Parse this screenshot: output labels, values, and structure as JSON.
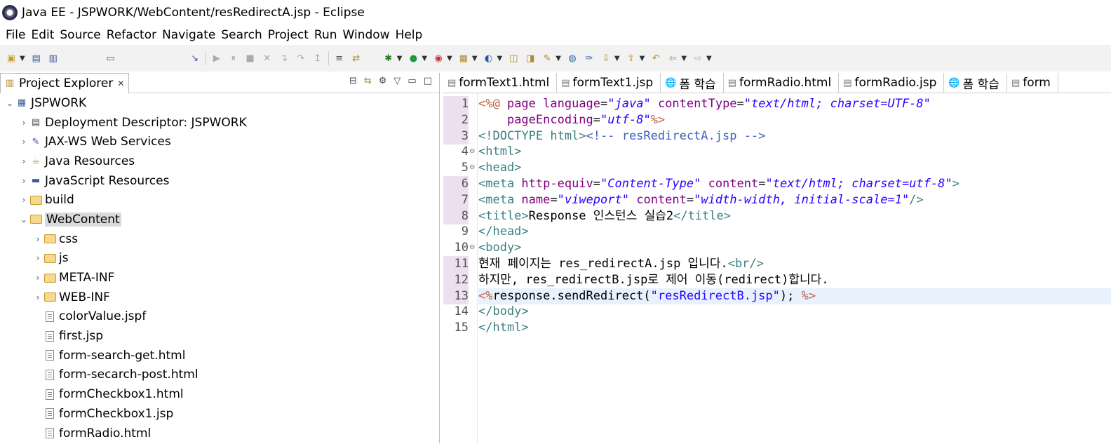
{
  "window": {
    "title": "Java EE - JSPWORK/WebContent/resRedirectA.jsp - Eclipse"
  },
  "menu": [
    "File",
    "Edit",
    "Source",
    "Refactor",
    "Navigate",
    "Search",
    "Project",
    "Run",
    "Window",
    "Help"
  ],
  "explorer": {
    "title": "Project Explorer",
    "close": "✕",
    "tree": [
      {
        "label": "JSPWORK",
        "level": 0,
        "arrow": "⌄",
        "icon": "project-icon"
      },
      {
        "label": "Deployment Descriptor: JSPWORK",
        "level": 1,
        "arrow": "›",
        "icon": "deployment-icon"
      },
      {
        "label": "JAX-WS Web Services",
        "level": 1,
        "arrow": "›",
        "icon": "webservices-icon"
      },
      {
        "label": "Java Resources",
        "level": 1,
        "arrow": "›",
        "icon": "java-resources-icon"
      },
      {
        "label": "JavaScript Resources",
        "level": 1,
        "arrow": "›",
        "icon": "javascript-resources-icon"
      },
      {
        "label": "build",
        "level": 1,
        "arrow": "›",
        "icon": "folder-icon"
      },
      {
        "label": "WebContent",
        "level": 1,
        "arrow": "⌄",
        "icon": "folder-open-icon",
        "selected": true
      },
      {
        "label": "css",
        "level": 2,
        "arrow": "›",
        "icon": "folder-icon"
      },
      {
        "label": "js",
        "level": 2,
        "arrow": "›",
        "icon": "folder-icon"
      },
      {
        "label": "META-INF",
        "level": 2,
        "arrow": "›",
        "icon": "folder-icon"
      },
      {
        "label": "WEB-INF",
        "level": 2,
        "arrow": "›",
        "icon": "folder-icon"
      },
      {
        "label": "colorValue.jspf",
        "level": 2,
        "arrow": "",
        "icon": "file-icon"
      },
      {
        "label": "first.jsp",
        "level": 2,
        "arrow": "",
        "icon": "file-icon"
      },
      {
        "label": "form-search-get.html",
        "level": 2,
        "arrow": "",
        "icon": "file-icon"
      },
      {
        "label": "form-secarch-post.html",
        "level": 2,
        "arrow": "",
        "icon": "file-icon"
      },
      {
        "label": "formCheckbox1.html",
        "level": 2,
        "arrow": "",
        "icon": "file-icon"
      },
      {
        "label": "formCheckbox1.jsp",
        "level": 2,
        "arrow": "",
        "icon": "file-icon"
      },
      {
        "label": "formRadio.html",
        "level": 2,
        "arrow": "",
        "icon": "file-icon"
      }
    ]
  },
  "editor_tabs": [
    {
      "label": "formText1.html",
      "icon": "file-icon"
    },
    {
      "label": "formText1.jsp",
      "icon": "file-icon"
    },
    {
      "label": "폼 학습",
      "icon": "globe-icon"
    },
    {
      "label": "formRadio.html",
      "icon": "file-icon"
    },
    {
      "label": "formRadio.jsp",
      "icon": "file-icon"
    },
    {
      "label": "폼 학습",
      "icon": "globe-icon"
    },
    {
      "label": "form",
      "icon": "file-icon"
    }
  ],
  "code": {
    "line_numbers": [
      "1",
      "2",
      "3",
      "4",
      "5",
      "6",
      "7",
      "8",
      "9",
      "10",
      "11",
      "12",
      "13",
      "14",
      "15"
    ],
    "lines": [
      [
        [
          "dir",
          "<%@ "
        ],
        [
          "attr",
          "page "
        ],
        [
          "attr",
          "language"
        ],
        [
          "plain",
          "="
        ],
        [
          "val",
          "\"java\""
        ],
        [
          "plain",
          " "
        ],
        [
          "attr",
          "contentType"
        ],
        [
          "plain",
          "="
        ],
        [
          "val",
          "\"text/html; charset=UTF-8\""
        ]
      ],
      [
        [
          "plain",
          "    "
        ],
        [
          "attr",
          "pageEncoding"
        ],
        [
          "plain",
          "="
        ],
        [
          "val",
          "\"utf-8\""
        ],
        [
          "dir",
          "%>"
        ]
      ],
      [
        [
          "tag",
          "<!DOCTYPE html>"
        ],
        [
          "cmt",
          "<!-- resRedirectA.jsp -->"
        ]
      ],
      [
        [
          "tag",
          "<html>"
        ]
      ],
      [
        [
          "tag",
          "<head>"
        ]
      ],
      [
        [
          "tag",
          "<meta "
        ],
        [
          "attr",
          "http-equiv"
        ],
        [
          "plain",
          "="
        ],
        [
          "val",
          "\"Content-Type\""
        ],
        [
          "plain",
          " "
        ],
        [
          "attr",
          "content"
        ],
        [
          "plain",
          "="
        ],
        [
          "val",
          "\"text/html; charset=utf-8\""
        ],
        [
          "tag",
          ">"
        ]
      ],
      [
        [
          "tag",
          "<meta "
        ],
        [
          "attr",
          "name"
        ],
        [
          "plain",
          "="
        ],
        [
          "val",
          "\"viweport\""
        ],
        [
          "plain",
          " "
        ],
        [
          "attr",
          "content"
        ],
        [
          "plain",
          "="
        ],
        [
          "val",
          "\"width-width, initial-scale=1\""
        ],
        [
          "tag",
          "/>"
        ]
      ],
      [
        [
          "tag",
          "<title>"
        ],
        [
          "plain",
          "Response 인스턴스 실습2"
        ],
        [
          "tag",
          "</title>"
        ]
      ],
      [
        [
          "tag",
          "</head>"
        ]
      ],
      [
        [
          "tag",
          "<body>"
        ]
      ],
      [
        [
          "plain",
          "현재 페이지는 res_redirectA.jsp 입니다."
        ],
        [
          "tag",
          "<br/>"
        ]
      ],
      [
        [
          "plain",
          "하지만, res_redirectB.jsp로 제어 이동(redirect)합니다."
        ]
      ],
      [
        [
          "dir",
          "<%"
        ],
        [
          "plain",
          "response.sendRedirect("
        ],
        [
          "str",
          "\"resRedirectB.jsp\""
        ],
        [
          "plain",
          ");"
        ],
        [
          "plain",
          " "
        ],
        [
          "dir",
          "%>"
        ]
      ],
      [
        [
          "tag",
          "</body>"
        ]
      ],
      [
        [
          "tag",
          "</html>"
        ]
      ]
    ]
  }
}
